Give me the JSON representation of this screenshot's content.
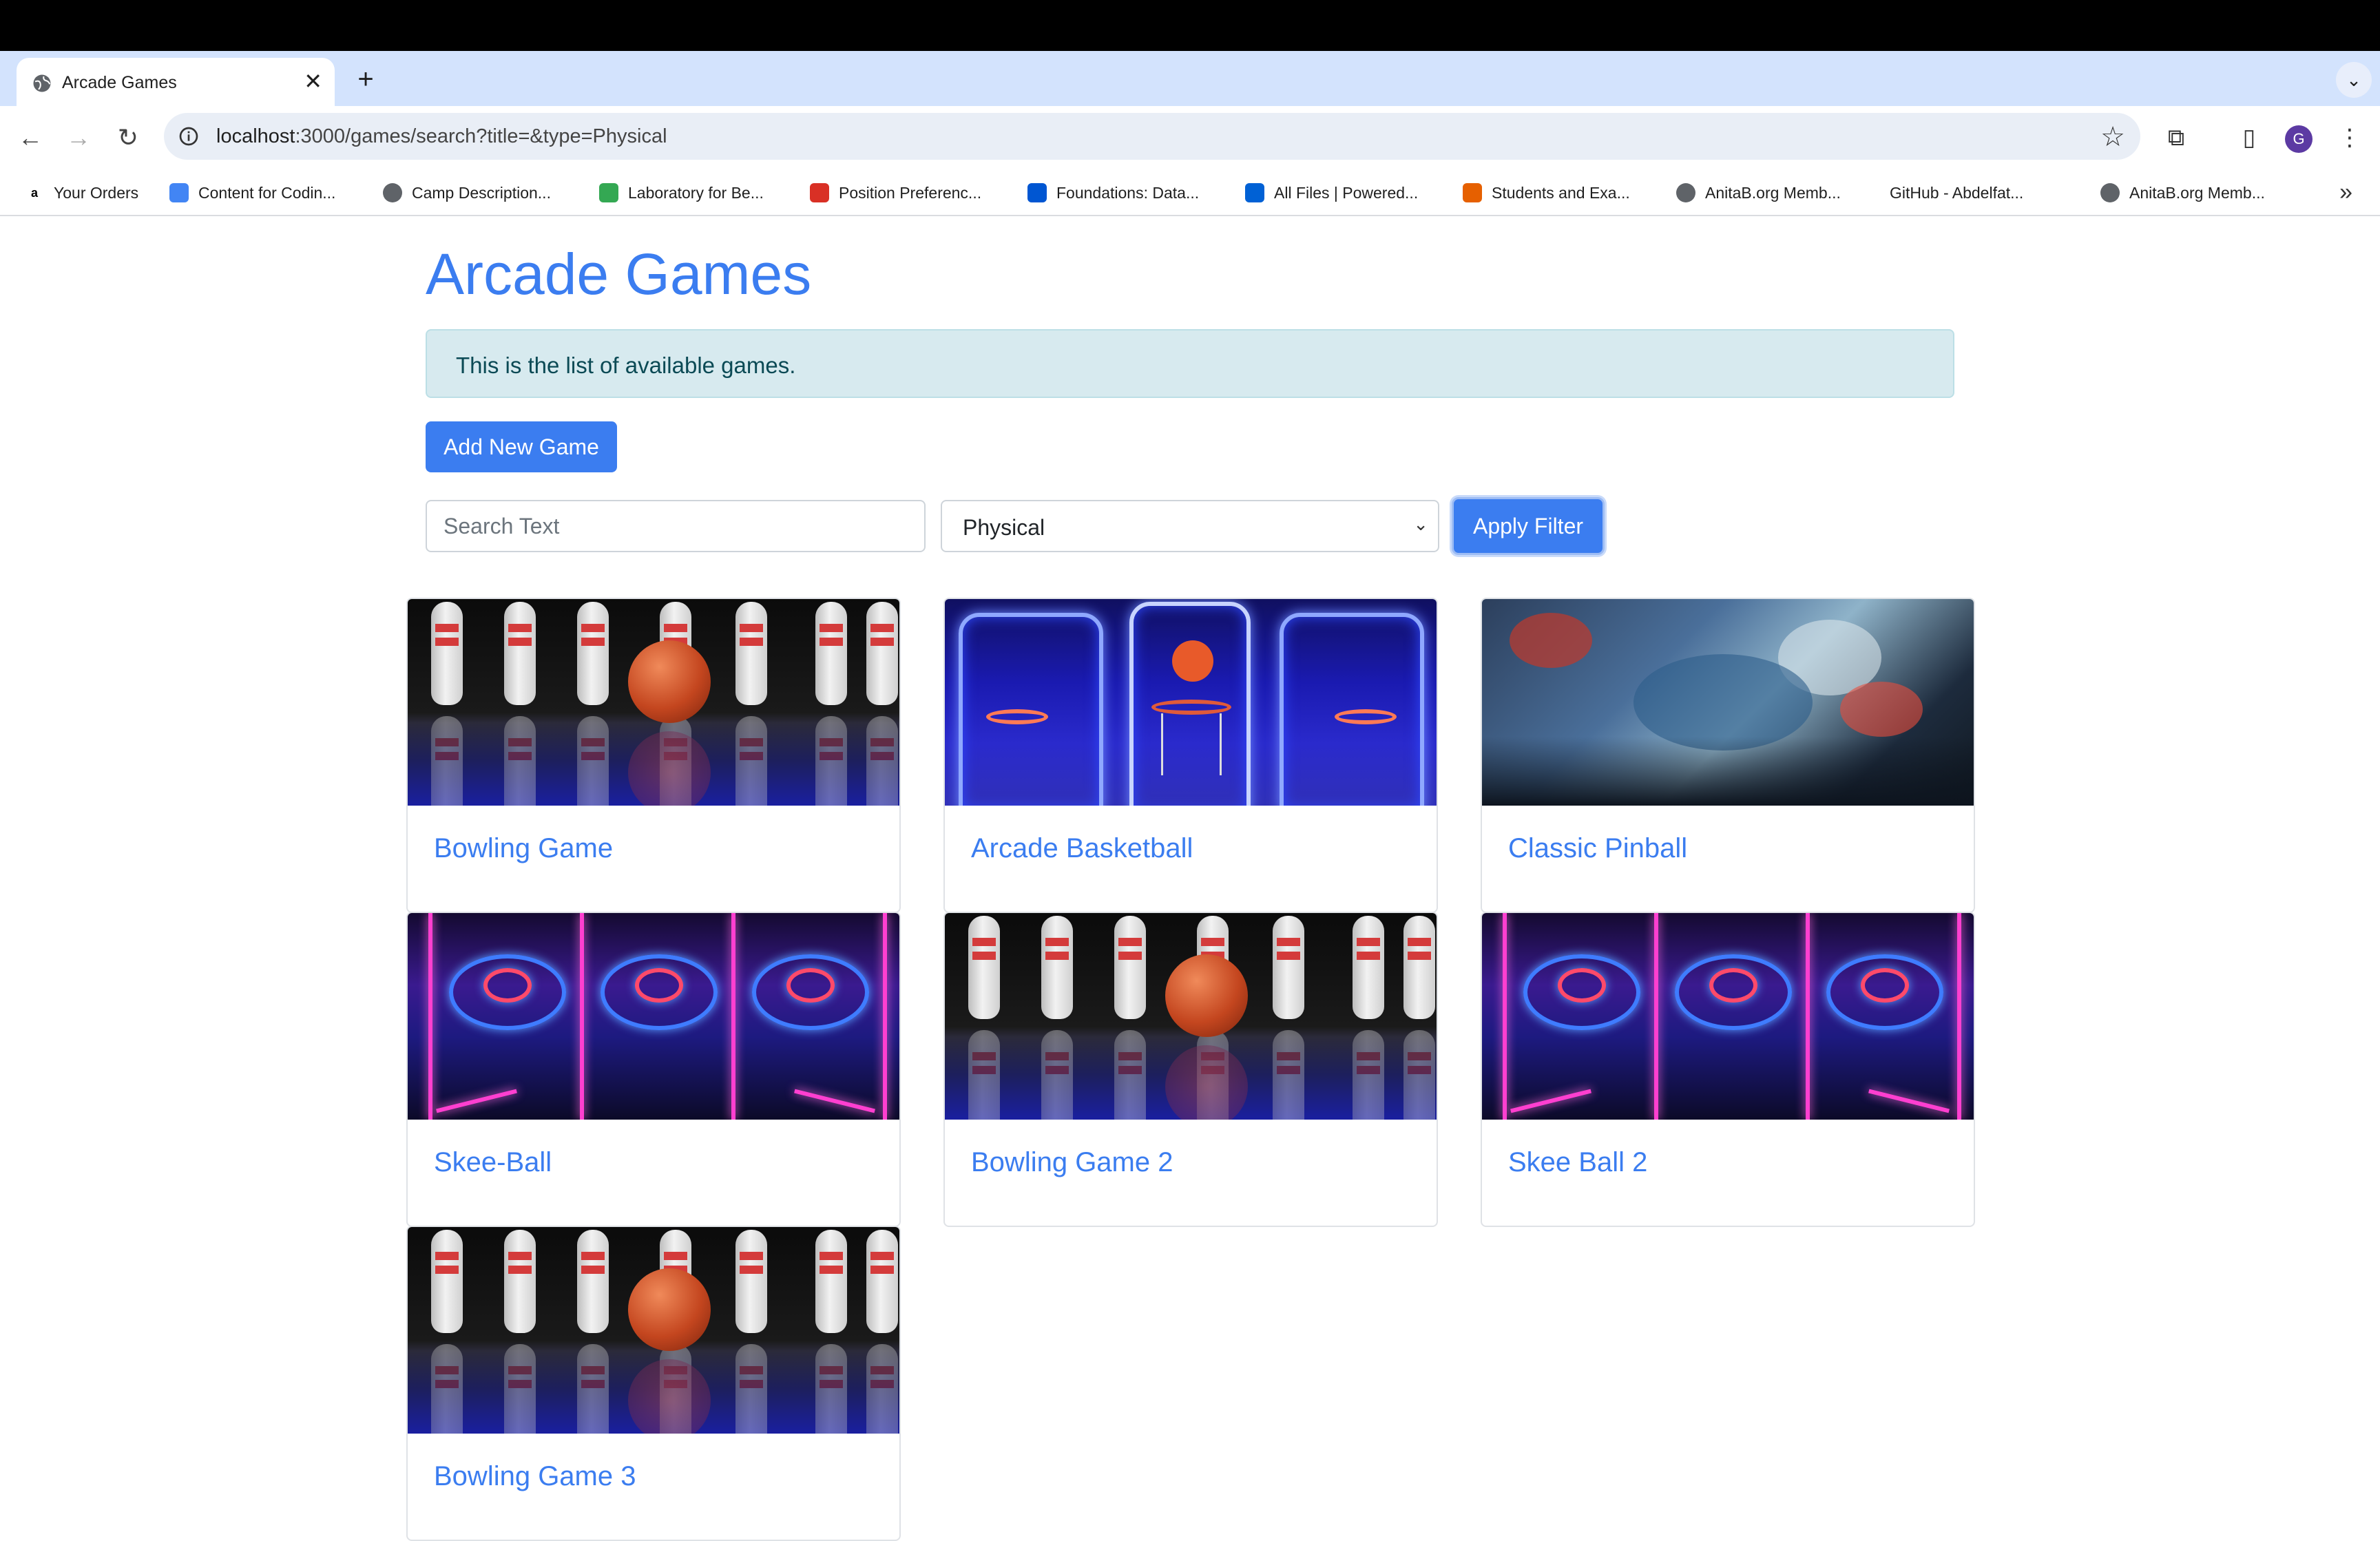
{
  "browser": {
    "tab_title": "Arcade Games",
    "url_host": "localhost",
    "url_rest": ":3000/games/search?title=&type=Physical",
    "profile_initial": "G",
    "bookmarks": [
      {
        "label": "Your Orders",
        "icon": "amazon-icon",
        "color": "#000000"
      },
      {
        "label": "Content for Codin...",
        "icon": "docs-icon",
        "color": "#4285f4"
      },
      {
        "label": "Camp Description...",
        "icon": "globe-icon",
        "color": "#5f6368"
      },
      {
        "label": "Laboratory for Be...",
        "icon": "lab-icon",
        "color": "#34a853"
      },
      {
        "label": "Position Preferenc...",
        "icon": "opera-icon",
        "color": "#d93025"
      },
      {
        "label": "Foundations: Data...",
        "icon": "coursera-icon",
        "color": "#0056d2"
      },
      {
        "label": "All Files | Powered...",
        "icon": "box-icon",
        "color": "#0061d5"
      },
      {
        "label": "Students and Exa...",
        "icon": "canvas-icon",
        "color": "#e66000"
      },
      {
        "label": "AnitaB.org Memb...",
        "icon": "globe-icon",
        "color": "#5f6368"
      },
      {
        "label": "GitHub - Abdelfat...",
        "icon": "github-icon",
        "color": "#ffffff"
      },
      {
        "label": "AnitaB.org Memb...",
        "icon": "globe-icon",
        "color": "#5f6368"
      }
    ]
  },
  "page": {
    "title": "Arcade Games",
    "alert": "This is the list of available games.",
    "add_button": "Add New Game",
    "search_placeholder": "Search Text",
    "type_selected": "Physical",
    "apply_button": "Apply Filter",
    "accent_color": "#3b7df0"
  },
  "games": [
    {
      "title": "Bowling Game",
      "image": "bowling"
    },
    {
      "title": "Arcade Basketball",
      "image": "basketball"
    },
    {
      "title": "Classic Pinball",
      "image": "pinball"
    },
    {
      "title": "Skee-Ball",
      "image": "skeeball"
    },
    {
      "title": "Bowling Game 2",
      "image": "bowling"
    },
    {
      "title": "Skee Ball 2",
      "image": "skeeball"
    },
    {
      "title": "Bowling Game 3",
      "image": "bowling"
    }
  ]
}
